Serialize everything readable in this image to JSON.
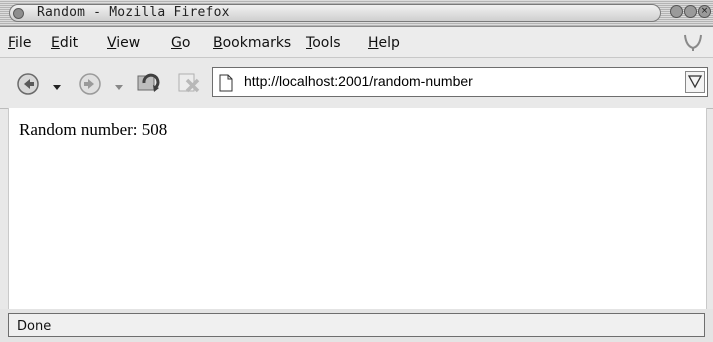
{
  "window": {
    "title": "Random - Mozilla Firefox"
  },
  "menu": {
    "items": [
      {
        "mnemonic": "F",
        "rest": "ile"
      },
      {
        "mnemonic": "E",
        "rest": "dit"
      },
      {
        "mnemonic": "V",
        "rest": "iew"
      },
      {
        "mnemonic": "G",
        "rest": "o"
      },
      {
        "mnemonic": "B",
        "rest": "ookmarks"
      },
      {
        "mnemonic": "T",
        "rest": "ools"
      },
      {
        "mnemonic": "H",
        "rest": "elp"
      }
    ]
  },
  "toolbar": {
    "icons": [
      "back-icon",
      "forward-icon",
      "reload-icon",
      "stop-icon"
    ]
  },
  "address": {
    "url": "http://localhost:2001/random-number"
  },
  "page": {
    "label": "Random number:",
    "value": "508"
  },
  "status": {
    "text": "Done"
  }
}
